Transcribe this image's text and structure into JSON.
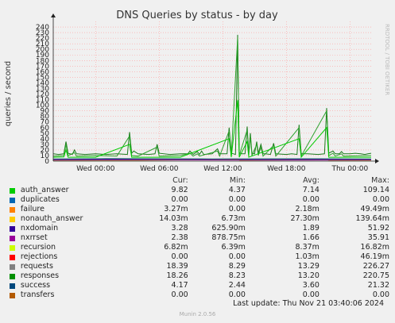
{
  "chart_data": {
    "type": "line",
    "title": "DNS Queries by status - by day",
    "ylabel": "queries / second",
    "side_label": "RRDTOOL / TOBI OETIKER",
    "ylim": [
      0,
      250
    ],
    "yticks": [
      0,
      10,
      20,
      30,
      40,
      50,
      60,
      70,
      80,
      90,
      100,
      110,
      120,
      130,
      140,
      150,
      160,
      170,
      180,
      190,
      200,
      210,
      220,
      230,
      240
    ],
    "xlim": [
      0,
      30
    ],
    "xticks": [
      {
        "at": 4,
        "label": "Wed 00:00"
      },
      {
        "at": 10,
        "label": "Wed 06:00"
      },
      {
        "at": 16,
        "label": "Wed 12:00"
      },
      {
        "at": 22,
        "label": "Wed 18:00"
      },
      {
        "at": 28,
        "label": "Thu 00:00"
      }
    ],
    "grid": true,
    "series": [
      {
        "name": "requests",
        "color": "#1a7a1a",
        "points": [
          [
            0,
            13
          ],
          [
            0.5,
            12
          ],
          [
            1,
            13
          ],
          [
            1.2,
            35
          ],
          [
            1.4,
            14
          ],
          [
            1.8,
            12
          ],
          [
            2,
            20
          ],
          [
            2.2,
            13
          ],
          [
            3,
            12
          ],
          [
            4,
            13
          ],
          [
            5,
            12
          ],
          [
            6,
            13
          ],
          [
            7,
            12
          ],
          [
            7.2,
            52
          ],
          [
            7.4,
            14
          ],
          [
            7.6,
            18
          ],
          [
            8,
            13
          ],
          [
            9,
            12
          ],
          [
            9.6,
            13
          ],
          [
            9.8,
            30
          ],
          [
            10,
            14
          ],
          [
            11,
            12
          ],
          [
            12,
            13
          ],
          [
            12.7,
            13
          ],
          [
            12.9,
            18
          ],
          [
            13.2,
            12
          ],
          [
            13.6,
            17
          ],
          [
            13.8,
            12
          ],
          [
            14,
            18
          ],
          [
            14.2,
            12
          ],
          [
            15,
            13
          ],
          [
            15.5,
            22
          ],
          [
            15.7,
            13
          ],
          [
            16,
            13
          ],
          [
            16.4,
            13
          ],
          [
            16.6,
            60
          ],
          [
            16.8,
            14
          ],
          [
            17,
            13
          ],
          [
            17.2,
            12
          ],
          [
            17.4,
            226
          ],
          [
            17.55,
            15
          ],
          [
            17.8,
            13
          ],
          [
            18.1,
            13
          ],
          [
            18.3,
            62
          ],
          [
            18.45,
            14
          ],
          [
            18.6,
            50
          ],
          [
            18.75,
            14
          ],
          [
            19,
            13
          ],
          [
            19.2,
            35
          ],
          [
            19.35,
            14
          ],
          [
            19.6,
            30
          ],
          [
            19.8,
            13
          ],
          [
            20,
            13
          ],
          [
            20.5,
            12
          ],
          [
            20.8,
            32
          ],
          [
            21,
            13
          ],
          [
            22,
            12
          ],
          [
            22.5,
            13
          ],
          [
            23,
            12
          ],
          [
            23.2,
            65
          ],
          [
            23.4,
            13
          ],
          [
            24,
            13
          ],
          [
            25,
            12
          ],
          [
            25.6,
            13
          ],
          [
            25.8,
            95
          ],
          [
            26,
            14
          ],
          [
            26.4,
            18
          ],
          [
            26.6,
            13
          ],
          [
            27,
            13
          ],
          [
            27.2,
            17
          ],
          [
            27.4,
            13
          ],
          [
            28,
            13
          ],
          [
            28.5,
            14
          ],
          [
            29,
            13
          ],
          [
            29.4,
            12
          ],
          [
            29.7,
            13
          ],
          [
            30,
            14
          ]
        ]
      },
      {
        "name": "responses",
        "color": "#2ca02c",
        "points": [
          [
            0,
            9
          ],
          [
            1,
            10
          ],
          [
            1.2,
            30
          ],
          [
            1.4,
            10
          ],
          [
            2,
            15
          ],
          [
            2.2,
            9
          ],
          [
            4,
            10
          ],
          [
            6,
            9
          ],
          [
            7.2,
            45
          ],
          [
            7.4,
            10
          ],
          [
            8,
            9
          ],
          [
            9.8,
            25
          ],
          [
            10,
            9
          ],
          [
            12,
            10
          ],
          [
            12.9,
            14
          ],
          [
            13.2,
            9
          ],
          [
            13.6,
            13
          ],
          [
            13.8,
            9
          ],
          [
            15.5,
            18
          ],
          [
            15.7,
            9
          ],
          [
            16.6,
            54
          ],
          [
            16.8,
            10
          ],
          [
            17.4,
            221
          ],
          [
            17.55,
            10
          ],
          [
            18.3,
            56
          ],
          [
            18.45,
            10
          ],
          [
            18.6,
            45
          ],
          [
            18.75,
            10
          ],
          [
            19.2,
            30
          ],
          [
            19.35,
            10
          ],
          [
            19.6,
            25
          ],
          [
            19.8,
            9
          ],
          [
            20.8,
            28
          ],
          [
            21,
            9
          ],
          [
            23.2,
            60
          ],
          [
            23.4,
            9
          ],
          [
            25.8,
            90
          ],
          [
            26,
            10
          ],
          [
            26.4,
            14
          ],
          [
            26.6,
            9
          ],
          [
            27.2,
            13
          ],
          [
            27.4,
            9
          ],
          [
            30,
            10
          ]
        ]
      },
      {
        "name": "nonauth_answer",
        "color": "#ccaa00",
        "points": [
          [
            0,
            1.5
          ],
          [
            8,
            1.5
          ],
          [
            17.4,
            3
          ],
          [
            17.6,
            1.5
          ],
          [
            25.8,
            2.5
          ],
          [
            26,
            1.5
          ],
          [
            30,
            1.5
          ]
        ]
      },
      {
        "name": "nxdomain",
        "color": "#2d2da0",
        "points": [
          [
            0,
            3
          ],
          [
            6,
            3.5
          ],
          [
            12,
            3
          ],
          [
            17.4,
            4
          ],
          [
            17.6,
            3
          ],
          [
            24,
            3.2
          ],
          [
            30,
            3
          ]
        ]
      },
      {
        "name": "nxrrset",
        "color": "#880088",
        "points": [
          [
            0,
            2
          ],
          [
            10,
            2.3
          ],
          [
            20,
            2
          ],
          [
            30,
            2.2
          ]
        ]
      },
      {
        "name": "success",
        "color": "#2a6e6e",
        "points": [
          [
            0,
            4
          ],
          [
            5,
            4.5
          ],
          [
            15,
            4
          ],
          [
            25,
            4.3
          ],
          [
            30,
            4
          ]
        ]
      },
      {
        "name": "auth_answer",
        "color": "#00cc00",
        "points": [
          [
            0,
            7
          ],
          [
            1,
            7.5
          ],
          [
            1.2,
            20
          ],
          [
            1.4,
            7
          ],
          [
            4,
            7
          ],
          [
            7.2,
            30
          ],
          [
            7.4,
            7
          ],
          [
            12,
            7
          ],
          [
            16.6,
            40
          ],
          [
            16.8,
            7
          ],
          [
            17.4,
            109
          ],
          [
            17.55,
            7
          ],
          [
            18.3,
            35
          ],
          [
            18.45,
            7
          ],
          [
            23.2,
            40
          ],
          [
            23.4,
            7
          ],
          [
            25.8,
            60
          ],
          [
            26,
            7
          ],
          [
            30,
            7
          ]
        ]
      }
    ]
  },
  "legend": {
    "header": {
      "cur": "Cur:",
      "min": "Min:",
      "avg": "Avg:",
      "max": "Max:"
    },
    "rows": [
      {
        "name": "auth_answer",
        "color": "#00cc00",
        "cur": "9.82",
        "min": "4.37",
        "avg": "7.14",
        "max": "109.14"
      },
      {
        "name": "duplicates",
        "color": "#0066b3",
        "cur": "0.00",
        "min": "0.00",
        "avg": "0.00",
        "max": "0.00"
      },
      {
        "name": "failure",
        "color": "#ff8000",
        "cur": "3.27m",
        "min": "0.00",
        "avg": "2.18m",
        "max": "49.49m"
      },
      {
        "name": "nonauth_answer",
        "color": "#ffcc00",
        "cur": "14.03m",
        "min": "6.73m",
        "avg": "27.30m",
        "max": "139.64m"
      },
      {
        "name": "nxdomain",
        "color": "#330099",
        "cur": "3.28",
        "min": "625.90m",
        "avg": "1.89",
        "max": "51.92"
      },
      {
        "name": "nxrrset",
        "color": "#990099",
        "cur": "2.38",
        "min": "878.75m",
        "avg": "1.66",
        "max": "35.91"
      },
      {
        "name": "recursion",
        "color": "#ccff00",
        "cur": "6.82m",
        "min": "6.39m",
        "avg": "8.37m",
        "max": "16.82m"
      },
      {
        "name": "rejections",
        "color": "#ff0000",
        "cur": "0.00",
        "min": "0.00",
        "avg": "1.03m",
        "max": "46.19m"
      },
      {
        "name": "requests",
        "color": "#808080",
        "cur": "18.39",
        "min": "8.29",
        "avg": "13.29",
        "max": "226.27"
      },
      {
        "name": "responses",
        "color": "#008f00",
        "cur": "18.26",
        "min": "8.23",
        "avg": "13.20",
        "max": "220.75"
      },
      {
        "name": "success",
        "color": "#00487d",
        "cur": "4.17",
        "min": "2.44",
        "avg": "3.60",
        "max": "21.32"
      },
      {
        "name": "transfers",
        "color": "#b35a00",
        "cur": "0.00",
        "min": "0.00",
        "avg": "0.00",
        "max": "0.00"
      }
    ]
  },
  "footer": {
    "last_update": "Last update: Thu Nov 21 03:40:06 2024",
    "munin": "Munin 2.0.56"
  }
}
